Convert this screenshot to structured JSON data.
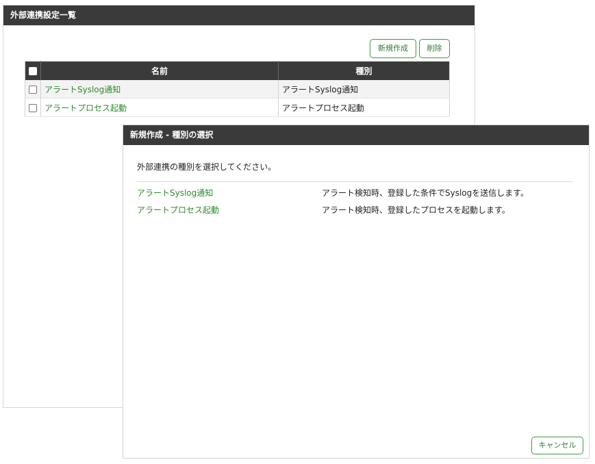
{
  "main": {
    "title": "外部連携設定一覧",
    "new_label": "新規作成",
    "delete_label": "削除",
    "columns": {
      "name": "名前",
      "type": "種別"
    },
    "rows": [
      {
        "name": "アラートSyslog通知",
        "type": "アラートSyslog通知"
      },
      {
        "name": "アラートプロセス起動",
        "type": "アラートプロセス起動"
      }
    ]
  },
  "dialog": {
    "title": "新規作成 - 種別の選択",
    "message": "外部連携の種別を選択してください。",
    "options": [
      {
        "name": "アラートSyslog通知",
        "description": "アラート検知時、登録した条件でSyslogを送信します。"
      },
      {
        "name": "アラートプロセス起動",
        "description": "アラート検知時、登録したプロセスを起動します。"
      }
    ],
    "cancel_label": "キャンセル"
  },
  "colors": {
    "header_bg": "#3a3a3a",
    "accent_green": "#2e8b2e"
  }
}
